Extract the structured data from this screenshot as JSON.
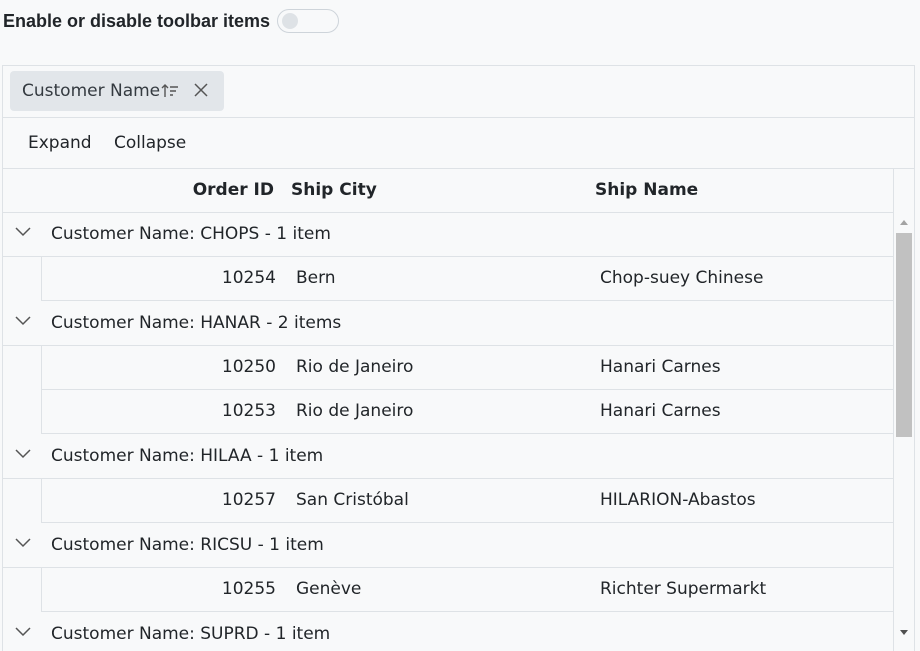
{
  "toggle": {
    "label": "Enable or disable toolbar items",
    "enabled": false
  },
  "group_area": {
    "chip_label": "Customer Name"
  },
  "toolbar": {
    "expand_label": "Expand",
    "collapse_label": "Collapse"
  },
  "columns": {
    "order_id": "Order ID",
    "ship_city": "Ship City",
    "ship_name": "Ship Name"
  },
  "groups": [
    {
      "caption": "Customer Name: CHOPS - 1 item",
      "rows": [
        {
          "order_id": "10254",
          "ship_city": "Bern",
          "ship_name": "Chop-suey Chinese"
        }
      ]
    },
    {
      "caption": "Customer Name: HANAR - 2 items",
      "rows": [
        {
          "order_id": "10250",
          "ship_city": "Rio de Janeiro",
          "ship_name": "Hanari Carnes"
        },
        {
          "order_id": "10253",
          "ship_city": "Rio de Janeiro",
          "ship_name": "Hanari Carnes"
        }
      ]
    },
    {
      "caption": "Customer Name: HILAA - 1 item",
      "rows": [
        {
          "order_id": "10257",
          "ship_city": "San Cristóbal",
          "ship_name": "HILARION-Abastos"
        }
      ]
    },
    {
      "caption": "Customer Name: RICSU - 1 item",
      "rows": [
        {
          "order_id": "10255",
          "ship_city": "Genève",
          "ship_name": "Richter Supermarkt"
        }
      ]
    },
    {
      "caption": "Customer Name: SUPRD - 1 item",
      "rows": []
    }
  ]
}
